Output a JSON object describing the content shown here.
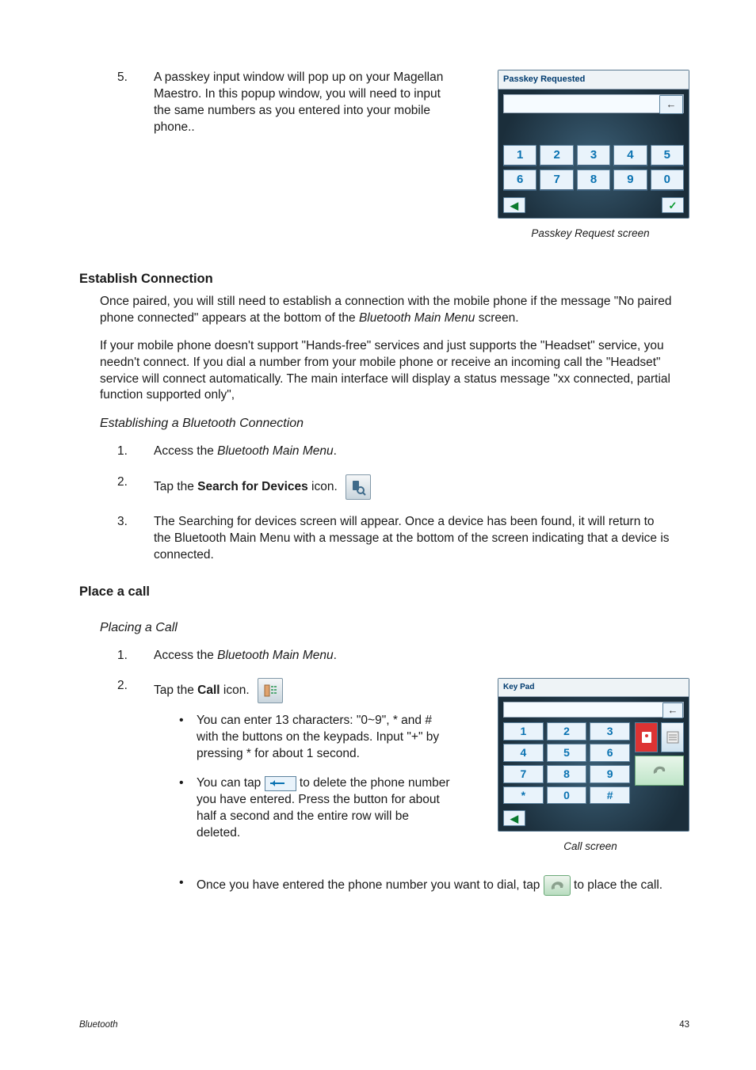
{
  "step5": {
    "n": "5.",
    "text": "A passkey input window will pop up on your Magellan Maestro. In this popup window, you will need to input the same numbers as you entered into your mobile phone.."
  },
  "passkey_screen": {
    "title": "Passkey Requested",
    "keys_row1": [
      "1",
      "2",
      "3",
      "4",
      "5"
    ],
    "keys_row2": [
      "6",
      "7",
      "8",
      "9",
      "0"
    ],
    "back_glyph": "◀",
    "backspace_glyph": "←",
    "ok_glyph": "✓",
    "caption": "Passkey Request screen"
  },
  "establish": {
    "heading": "Establish Connection",
    "p1a": "Once paired, you will still need to establish a connection with the mobile phone if the message \"No paired phone connected\" appears at the bottom of the ",
    "p1b": "Bluetooth Main Menu",
    "p1c": " screen.",
    "p2": "If your mobile phone doesn't support \"Hands-free\" services and just supports the \"Headset\" service, you needn't connect. If you dial a number from your mobile phone or receive an incoming call the \"Headset\" service will connect automatically. The main interface will display a status message \"xx connected, partial function supported only\",",
    "sub": "Establishing a Bluetooth Connection",
    "s1": {
      "n": "1.",
      "a": "Access the ",
      "b": "Bluetooth Main Menu",
      "c": "."
    },
    "s2": {
      "n": "2.",
      "a": "Tap the ",
      "b": "Search for Devices",
      "c": " icon."
    },
    "s3": {
      "n": "3.",
      "text": "The Searching for devices screen will appear.  Once a device has been found, it will return to the Bluetooth Main Menu with a message at the bottom of the screen indicating that a device is connected."
    }
  },
  "placecall": {
    "heading": "Place a call",
    "sub": "Placing a Call",
    "s1": {
      "n": "1.",
      "a": "Access the ",
      "b": "Bluetooth Main Menu",
      "c": "."
    },
    "s2": {
      "n": "2.",
      "a": "Tap the ",
      "b": "Call",
      "c": " icon."
    },
    "b1": "You can enter 13 characters: \"0~9\", * and # with the buttons on the keypads. Input \"+\" by pressing * for about 1 second.",
    "b2a": "You can tap ",
    "b2b": " to delete the phone number you have entered. Press the button for about half a second and the entire row will be deleted.",
    "b3a": "Once you have entered the phone number you want to dial, tap ",
    "b3b": " to place the call."
  },
  "call_screen": {
    "title": "Key Pad",
    "rows": [
      [
        "1",
        "2",
        "3"
      ],
      [
        "4",
        "5",
        "6"
      ],
      [
        "7",
        "8",
        "9"
      ],
      [
        "*",
        "0",
        "#"
      ]
    ],
    "back_glyph": "◀",
    "backspace_glyph": "←",
    "caption": "Call screen"
  },
  "footer": {
    "left": "Bluetooth",
    "right": "43"
  }
}
